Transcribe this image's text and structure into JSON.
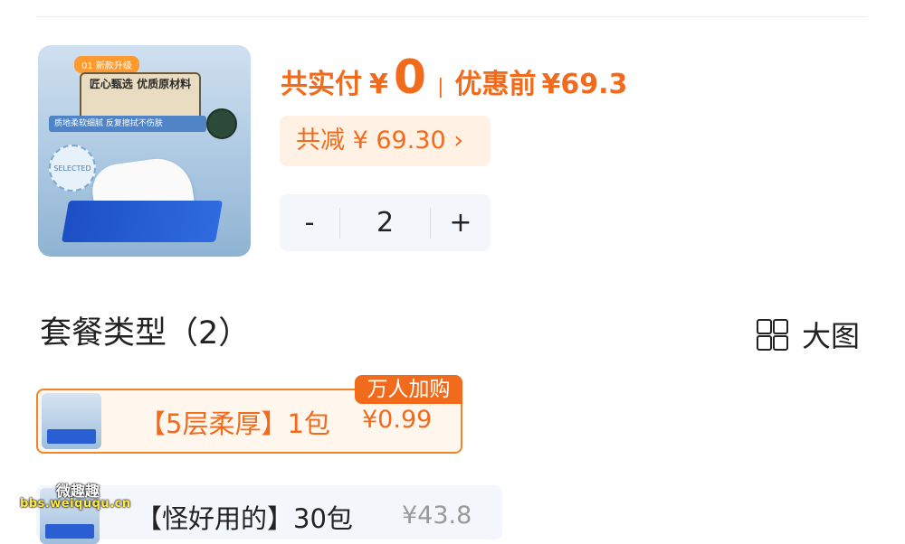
{
  "product": {
    "image_tag": "01 新款升级",
    "image_title": "匠心甄选 优质原材料",
    "image_subtitle": "质地柔软细腻 反复擦拭不伤肤",
    "image_seal": "SELECTED"
  },
  "payment": {
    "paid_label": "共实付",
    "currency": "¥",
    "paid_value": "0",
    "separator": "|",
    "before_label": "优惠前",
    "before_value": "¥69.3",
    "discount_text": "共减 ¥ 69.30 ›"
  },
  "stepper": {
    "minus": "-",
    "quantity": "2",
    "plus": "+"
  },
  "package": {
    "title": "套餐类型（2）",
    "view_label": "大图",
    "options": [
      {
        "label": "【5层柔厚】1包",
        "price": "¥0.99",
        "badge": "万人加购"
      },
      {
        "label": "【怪好用的】30包",
        "price": "¥43.8"
      }
    ]
  },
  "watermark": {
    "line1": "微趣趣",
    "line2": "bbs.weiququ.cn"
  }
}
